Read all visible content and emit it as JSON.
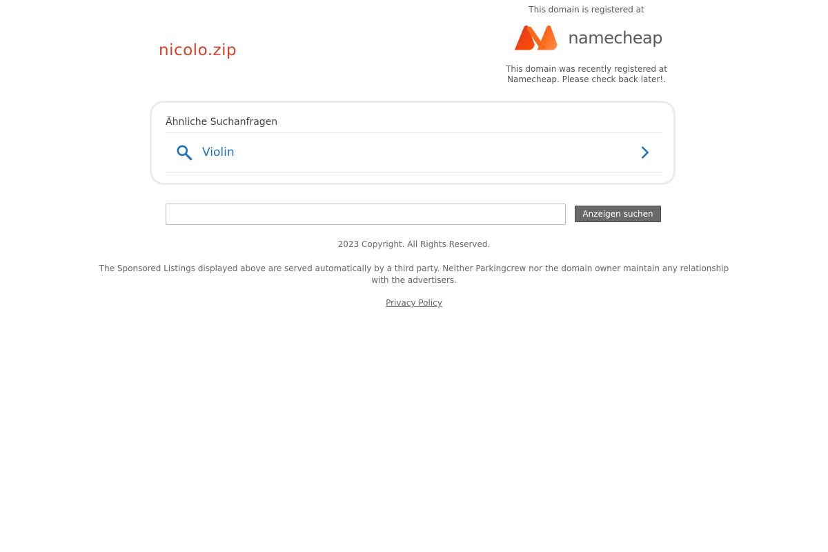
{
  "domain": {
    "name": "nicolo.zip",
    "color": "#d6402b"
  },
  "registrar": {
    "top_text": "This domain is registered at",
    "logo_name": "namecheap",
    "logo_icon": "namecheap-logo-icon",
    "logo_colors": [
      "#de3723",
      "#fd4f00",
      "#ff8c44"
    ],
    "bottom_text_line1": "This domain was recently registered at",
    "bottom_text_line2": "Namecheap. Please check back later!."
  },
  "related": {
    "heading": "Ähnliche Suchanfragen",
    "items": [
      {
        "label": "Violin",
        "icon": "search-icon",
        "arrow_icon": "chevron-right-icon"
      }
    ],
    "link_color": "#1f6fc0"
  },
  "search": {
    "input_value": "",
    "button_label": "Anzeigen suchen"
  },
  "footer": {
    "copyright": "2023 Copyright. All Rights Reserved.",
    "disclaimer": "The Sponsored Listings displayed above are served automatically by a third party. Neither Parkingcrew nor the domain owner maintain any relationship with the advertisers.",
    "privacy_label": "Privacy Policy"
  }
}
